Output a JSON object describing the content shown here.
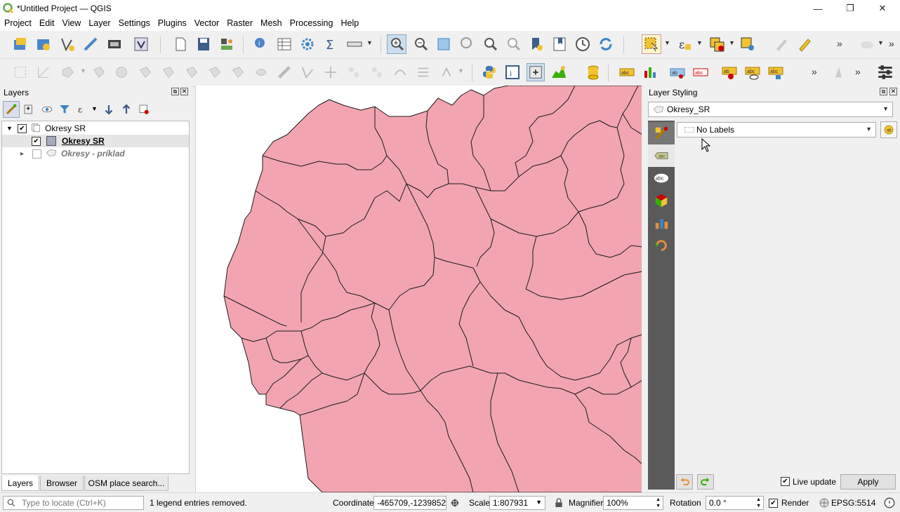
{
  "window": {
    "title": "*Untitled Project — QGIS",
    "controls": {
      "minimize": "—",
      "restore": "❐",
      "close": "✕"
    }
  },
  "menu": [
    "Project",
    "Edit",
    "View",
    "Layer",
    "Settings",
    "Plugins",
    "Vector",
    "Raster",
    "Mesh",
    "Processing",
    "Help"
  ],
  "layers_panel": {
    "title": "Layers",
    "tree": [
      {
        "label": "Okresy SR",
        "checked": true,
        "type": "group",
        "expanded": true
      },
      {
        "label": "Okresy SR",
        "checked": true,
        "type": "layer",
        "selected": true
      },
      {
        "label": "Okresy - príklad",
        "checked": false,
        "type": "layer",
        "expander": "▸"
      }
    ],
    "tabs": [
      "Layers",
      "Browser",
      "OSM place search..."
    ]
  },
  "styling_panel": {
    "title": "Layer Styling",
    "layer_combo": "Okresy_SR",
    "labels_combo": "No Labels",
    "live_update_label": "Live update",
    "live_update_checked": true,
    "apply_label": "Apply"
  },
  "status": {
    "locate_placeholder": "Type to locate (Ctrl+K)",
    "message": "1 legend entries removed.",
    "coordinate_label": "Coordinate",
    "coordinate_value": "-465709,-1239852",
    "scale_label": "Scale",
    "scale_value": "1:807931",
    "magnifier_label": "Magnifier",
    "magnifier_value": "100%",
    "rotation_label": "Rotation",
    "rotation_value": "0.0 °",
    "render_label": "Render",
    "render_checked": true,
    "crs": "EPSG:5514"
  },
  "colors": {
    "polygon_fill": "#f2a5b0",
    "polygon_stroke": "#1a1a1a",
    "side_tabs_bg": "#5a5a5a",
    "selected_row": "#e5e5e5"
  },
  "icons": {
    "toolbar1": [
      "new-project-icon",
      "open-project-icon",
      "new-vector-icon",
      "digitize-icon",
      "layout-icon",
      "style-manager-icon",
      "new-file-icon",
      "save-icon",
      "style-icon",
      "identify-icon",
      "attribute-table-icon",
      "settings-icon",
      "sum-icon",
      "measure-icon",
      "zoom-in-icon",
      "zoom-out-icon",
      "zoom-full-icon",
      "zoom-native-icon",
      "zoom-layer-icon",
      "zoom-last-icon",
      "new-bookmark-icon",
      "bookmarks-icon",
      "temporal-icon",
      "refresh-icon",
      "select-icon",
      "expression-select-icon",
      "deselect-icon",
      "select-location-icon",
      "edit-pencil-icon",
      "edit-toggle-icon",
      "cloud-icon"
    ],
    "toolbar2": [
      "python-icon",
      "metadata-icon",
      "layer-properties-icon",
      "profile-icon",
      "database-icon",
      "label-icon",
      "diagram-icon",
      "pin-label-icon",
      "show-label-icon",
      "move-label-icon",
      "rotate-label-icon",
      "change-label-icon",
      "processing-toolbox-icon"
    ]
  }
}
